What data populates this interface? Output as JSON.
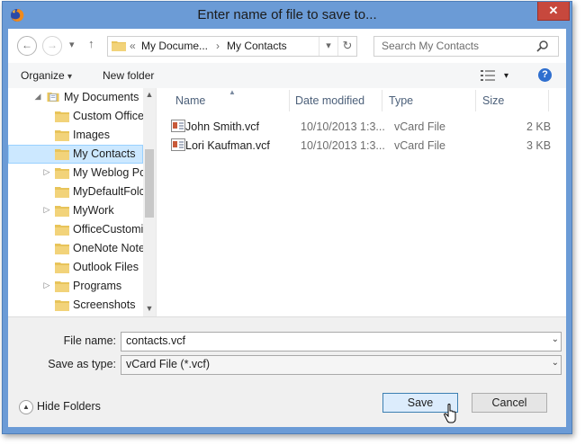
{
  "window": {
    "title": "Enter name of file to save to...",
    "close_symbol": "✕"
  },
  "navigation": {
    "back_symbol": "←",
    "forward_symbol": "→",
    "recent_symbol": "▾",
    "up_symbol": "↑",
    "breadcrumb_overflow": "«",
    "breadcrumb": [
      "My Docume...",
      "My Contacts"
    ],
    "breadcrumb_sep": "›",
    "address_dropdown_symbol": "▾",
    "refresh_symbol": "↻"
  },
  "search": {
    "placeholder": "Search My Contacts"
  },
  "toolbar": {
    "organize_label": "Organize",
    "organize_arrow": "▾",
    "new_folder_label": "New folder",
    "view_arrow": "▾",
    "help_symbol": "?"
  },
  "tree": {
    "items": [
      {
        "label": "My Documents",
        "expander": "◢"
      },
      {
        "label": "Custom Office",
        "expander": ""
      },
      {
        "label": "Images",
        "expander": ""
      },
      {
        "label": "My Contacts",
        "expander": ""
      },
      {
        "label": "My Weblog Po",
        "expander": "▷"
      },
      {
        "label": "MyDefaultFolc",
        "expander": ""
      },
      {
        "label": "MyWork",
        "expander": "▷"
      },
      {
        "label": "OfficeCustomi",
        "expander": ""
      },
      {
        "label": "OneNote Note",
        "expander": ""
      },
      {
        "label": "Outlook Files",
        "expander": ""
      },
      {
        "label": "Programs",
        "expander": "▷"
      },
      {
        "label": "Screenshots",
        "expander": ""
      }
    ],
    "scroll_up": "▲",
    "scroll_down": "▼"
  },
  "filelist": {
    "columns": [
      "Name",
      "Date modified",
      "Type",
      "Size"
    ],
    "sort_indicator": "▲",
    "rows": [
      {
        "name": "John Smith.vcf",
        "date": "10/10/2013 1:3...",
        "type": "vCard File",
        "size": "2 KB"
      },
      {
        "name": "Lori Kaufman.vcf",
        "date": "10/10/2013 1:3...",
        "type": "vCard File",
        "size": "3 KB"
      }
    ]
  },
  "form": {
    "file_name_label": "File name:",
    "file_name_value": "contacts.vcf",
    "save_type_label": "Save as type:",
    "save_type_value": "vCard File (*.vcf)",
    "combo_arrow": "⌄"
  },
  "footer": {
    "hide_folders_label": "Hide Folders",
    "hide_folders_symbol": "▲",
    "save_label": "Save",
    "cancel_label": "Cancel"
  },
  "colors": {
    "frame": "#6b9bd6",
    "close_button": "#c7483d",
    "selection": "#cce8ff",
    "folder": "#e8c45a",
    "primary_button": "#dcecfc"
  }
}
